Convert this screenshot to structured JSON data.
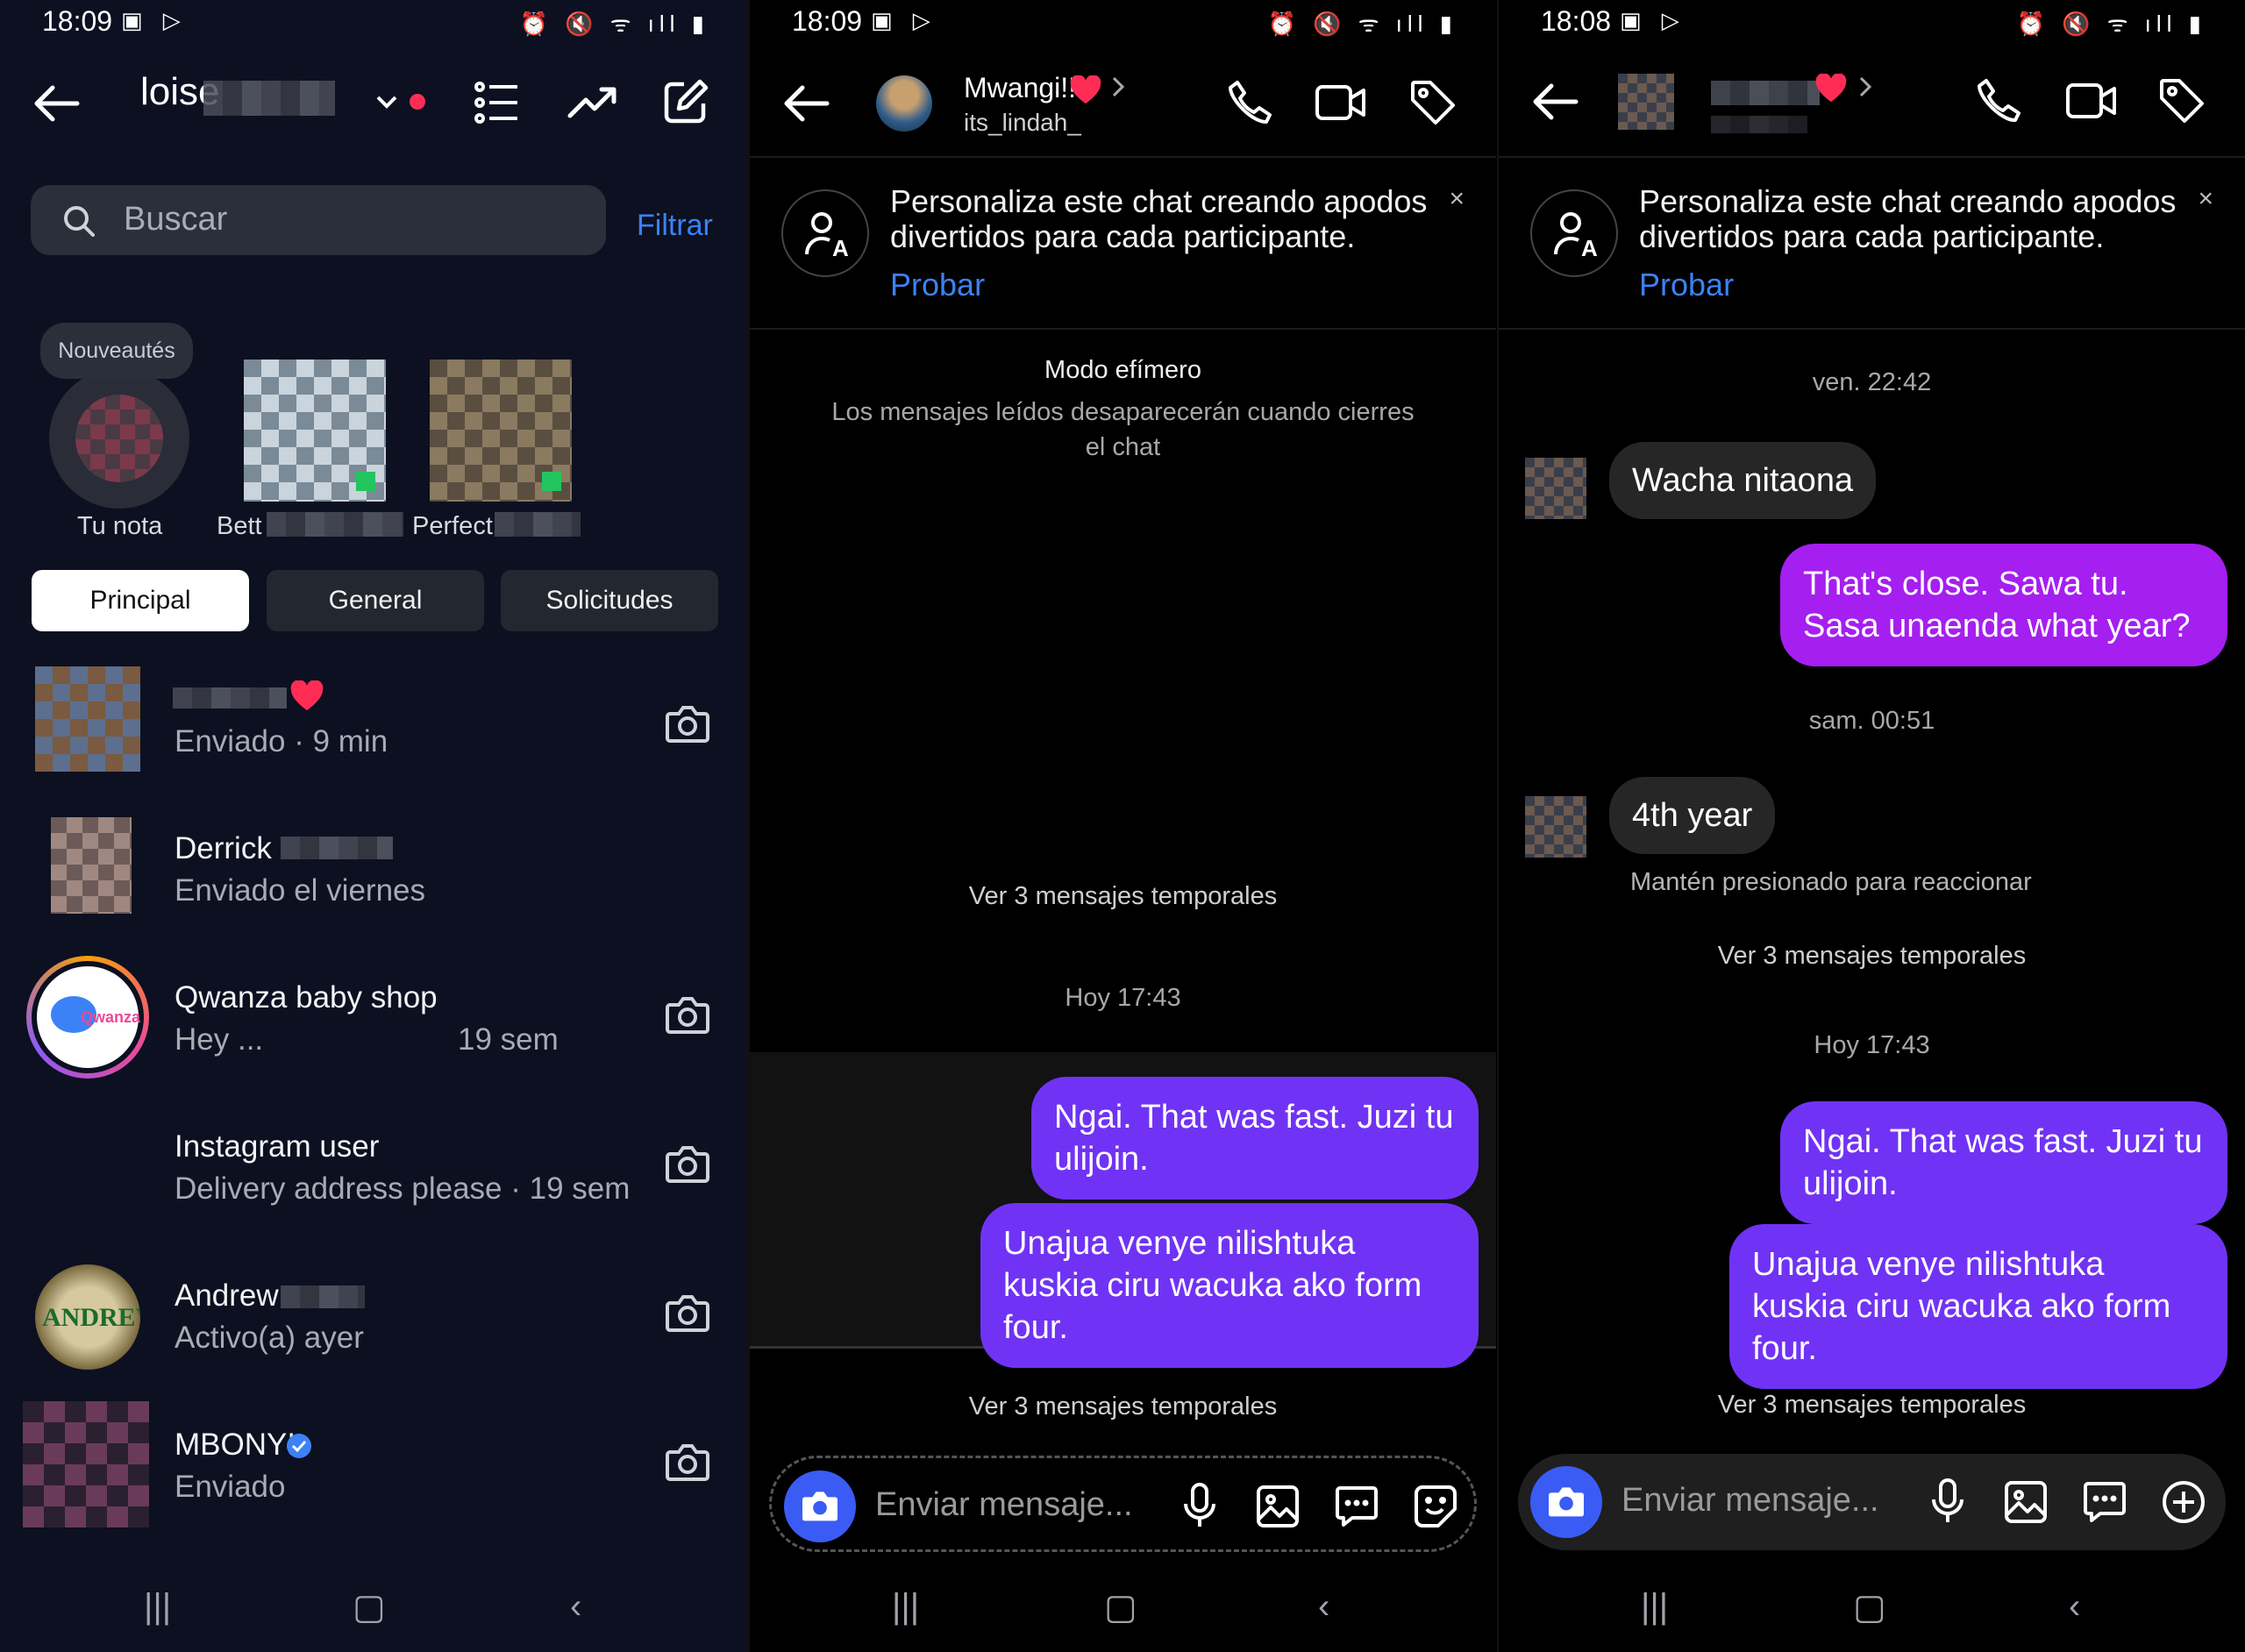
{
  "panel1": {
    "status_time": "18:09",
    "title": "loise",
    "search_placeholder": "Buscar",
    "filter": "Filtrar",
    "note_bubble": "Nouveautés",
    "stories": [
      {
        "label": "Tu nota"
      },
      {
        "label": "Bett"
      },
      {
        "label": "Perfect"
      }
    ],
    "tabs": [
      "Principal",
      "General",
      "Solicitudes"
    ],
    "threads": [
      {
        "name": "",
        "sub": "Enviado · 9 min"
      },
      {
        "name": "Derrick",
        "sub": "Enviado el viernes"
      },
      {
        "name": "Qwanza baby shop",
        "sub": "Hey ...",
        "time": "19 sem"
      },
      {
        "name": "Instagram user",
        "sub": "Delivery address please · 19 sem"
      },
      {
        "name": "Andrew",
        "sub": "Activo(a) ayer"
      },
      {
        "name": "MBONYI",
        "sub": "Enviado"
      }
    ],
    "avatar_text_andrew": "ANDREW"
  },
  "panel2": {
    "status_time": "18:09",
    "name": "Mwangi!!",
    "username": "its_lindah_",
    "banner_text": "Personaliza este chat creando apodos divertidos para cada participante.",
    "banner_cta": "Probar",
    "banner_close": "×",
    "ephemeral_title": "Modo efímero",
    "ephemeral_desc": "Los mensajes leídos desaparecerán cuando cierres el chat",
    "see_temp_1": "Ver 3 mensajes temporales",
    "timestamp": "Hoy 17:43",
    "messages_out": [
      "Ngai. That was fast. Juzi tu ulijoin.",
      "Unajua venye nilishtuka kuskia ciru wacuka ako form four."
    ],
    "see_temp_2": "Ver 3 mensajes temporales",
    "composer_placeholder": "Enviar mensaje..."
  },
  "panel3": {
    "status_time": "18:08",
    "banner_text": "Personaliza este chat creando apodos divertidos para cada participante.",
    "banner_cta": "Probar",
    "banner_close": "×",
    "ts1": "ven. 22:42",
    "msg_in_1": "Wacha nitaona",
    "msg_out_1": "That's close. Sawa tu. Sasa unaenda what year?",
    "ts2": "sam. 00:51",
    "msg_in_2": "4th year",
    "hint": "Mantén presionado para reaccionar",
    "see_temp_1": "Ver 3 mensajes temporales",
    "ts3": "Hoy 17:43",
    "messages_out": [
      "Ngai. That was fast. Juzi tu ulijoin.",
      "Unajua venye nilishtuka kuskia ciru wacuka ako form four."
    ],
    "see_temp_2": "Ver 3 mensajes temporales",
    "composer_placeholder": "Enviar mensaje..."
  },
  "colors": {
    "accent_blue": "#3b82f6",
    "bubble_purple": "#7033f5",
    "bubble_magenta": "#a51ff0",
    "heart_red": "#ff2d55"
  }
}
